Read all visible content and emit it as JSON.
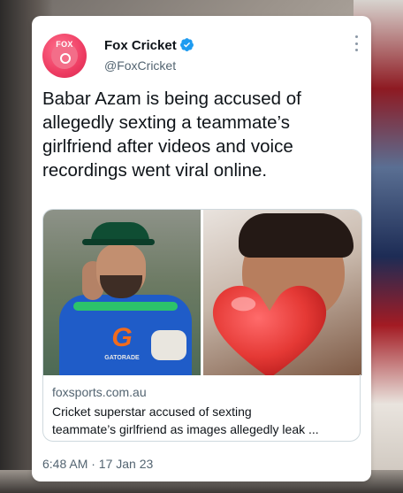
{
  "tweet": {
    "author_name": "Fox Cricket",
    "author_handle": "@FoxCricket",
    "avatar_text": "FOX",
    "verified": true,
    "text": "Babar Azam is being accused of\nallegedly sexting a teammate’s\ngirlfriend after videos and voice\nrecordings went viral online.",
    "timestamp": "6:48 AM · 17 Jan 23"
  },
  "link_card": {
    "domain": "foxsports.com.au",
    "headline": "Cricket superstar accused of sexting\nteammate’s girlfriend as images allegedly leak ..."
  },
  "media": {
    "left_image": "cricketer-in-green-cap-and-blue-jersey",
    "left_sponsor_text": "GATORADE",
    "right_image": "selfie-with-heart-emoji-overlay"
  },
  "colors": {
    "brand_pink": "#ee3d63",
    "verified_blue": "#1d9bf0",
    "text_primary": "#0f1419",
    "text_secondary": "#536471"
  }
}
